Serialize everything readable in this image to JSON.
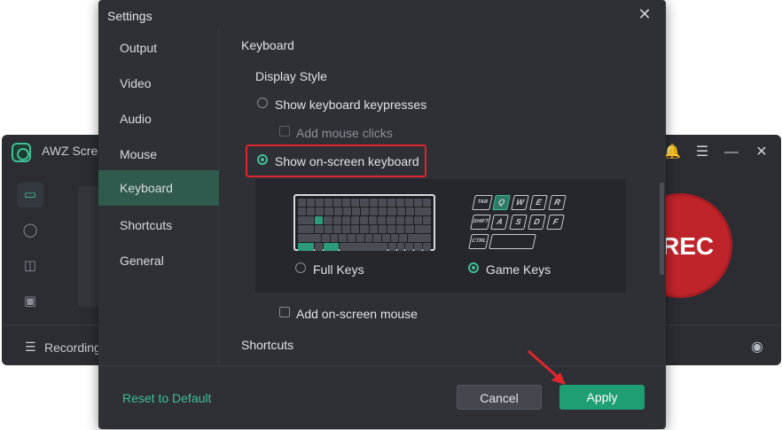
{
  "background_app": {
    "title": "AWZ Scree",
    "footer_label": "Recording",
    "rec_label": "REC",
    "side_icons": [
      "monitor-icon",
      "headphones-icon",
      "gamepad-icon",
      "tv-icon"
    ]
  },
  "dialog": {
    "title": "Settings",
    "nav": [
      "Output",
      "Video",
      "Audio",
      "Mouse",
      "Keyboard",
      "Shortcuts",
      "General"
    ],
    "active_nav": "Keyboard",
    "section_title": "Keyboard",
    "display_style_label": "Display Style",
    "options": {
      "show_keypresses": "Show keyboard keypresses",
      "add_mouse_clicks": "Add mouse clicks",
      "show_onscreen_keyboard": "Show on-screen keyboard",
      "full_keys": "Full Keys",
      "game_keys": "Game Keys",
      "add_onscreen_mouse": "Add on-screen mouse"
    },
    "selected_display_style": "Show on-screen keyboard",
    "selected_keyboard_layout": "Game Keys",
    "next_section_title": "Shortcuts",
    "game_keys": {
      "row1": [
        "TAB",
        "Q",
        "W",
        "E",
        "R"
      ],
      "row2": [
        "SHIFT",
        "A",
        "S",
        "D",
        "F"
      ],
      "row3": [
        "CTRL"
      ]
    },
    "footer": {
      "reset_label": "Reset to Default",
      "cancel_label": "Cancel",
      "apply_label": "Apply"
    }
  },
  "colors": {
    "accent": "#3fbf93",
    "highlight_border": "#e0262c",
    "rec_red": "#c0242b"
  }
}
